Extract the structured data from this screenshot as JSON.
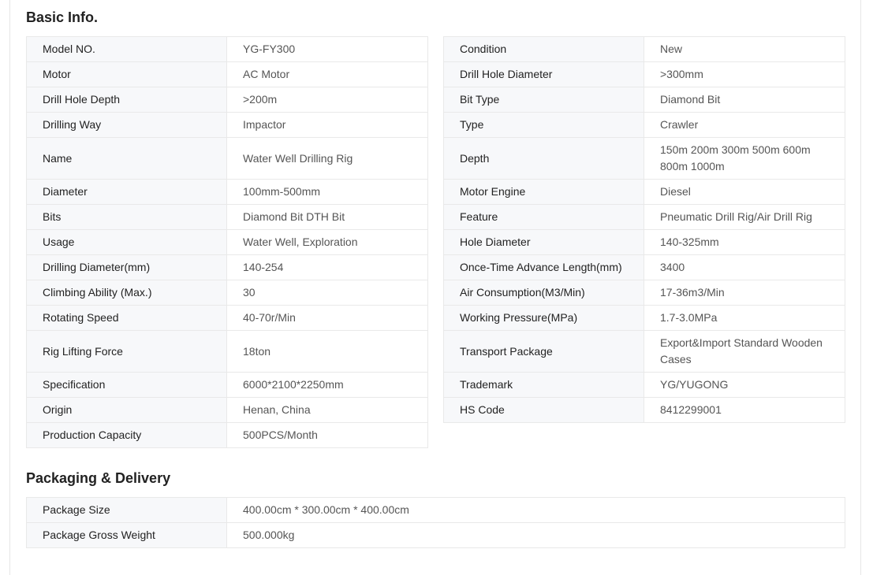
{
  "basic_info": {
    "title": "Basic Info.",
    "left": [
      {
        "label": "Model NO.",
        "value": "YG-FY300"
      },
      {
        "label": "Motor",
        "value": "AC Motor"
      },
      {
        "label": "Drill Hole Depth",
        "value": ">200m"
      },
      {
        "label": "Drilling Way",
        "value": "Impactor"
      },
      {
        "label": "Name",
        "value": "Water Well Drilling Rig"
      },
      {
        "label": "Diameter",
        "value": "100mm-500mm"
      },
      {
        "label": "Bits",
        "value": "Diamond Bit DTH Bit"
      },
      {
        "label": "Usage",
        "value": "Water Well, Exploration"
      },
      {
        "label": "Drilling Diameter(mm)",
        "value": "140-254"
      },
      {
        "label": "Climbing Ability (Max.)",
        "value": "30"
      },
      {
        "label": "Rotating Speed",
        "value": "40-70r/Min"
      },
      {
        "label": "Rig Lifting Force",
        "value": "18ton"
      },
      {
        "label": "Specification",
        "value": "6000*2100*2250mm"
      },
      {
        "label": "Origin",
        "value": "Henan, China"
      },
      {
        "label": "Production Capacity",
        "value": "500PCS/Month"
      }
    ],
    "right": [
      {
        "label": "Condition",
        "value": "New"
      },
      {
        "label": "Drill Hole Diameter",
        "value": ">300mm"
      },
      {
        "label": "Bit Type",
        "value": "Diamond Bit"
      },
      {
        "label": "Type",
        "value": "Crawler"
      },
      {
        "label": "Depth",
        "value": "150m 200m 300m 500m 600m 800m 1000m"
      },
      {
        "label": "Motor Engine",
        "value": "Diesel"
      },
      {
        "label": "Feature",
        "value": "Pneumatic Drill Rig/Air Drill Rig"
      },
      {
        "label": "Hole Diameter",
        "value": "140-325mm"
      },
      {
        "label": "Once-Time Advance Length(mm)",
        "value": "3400"
      },
      {
        "label": "Air Consumption(M3/Min)",
        "value": "17-36m3/Min"
      },
      {
        "label": "Working Pressure(MPa)",
        "value": "1.7-3.0MPa"
      },
      {
        "label": "Transport Package",
        "value": "Export&Import Standard Wooden Cases"
      },
      {
        "label": "Trademark",
        "value": "YG/YUGONG"
      },
      {
        "label": "HS Code",
        "value": "8412299001"
      }
    ]
  },
  "packaging": {
    "title": "Packaging & Delivery",
    "rows": [
      {
        "label": "Package Size",
        "value": "400.00cm * 300.00cm * 400.00cm"
      },
      {
        "label": "Package Gross Weight",
        "value": "500.000kg"
      }
    ]
  }
}
